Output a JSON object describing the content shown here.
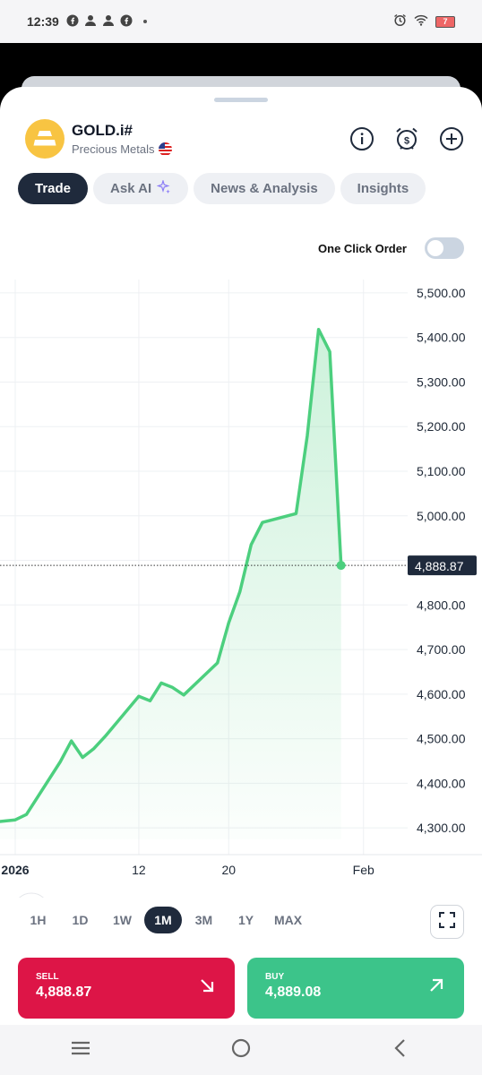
{
  "status_bar": {
    "time": "12:39",
    "battery": "7"
  },
  "instrument": {
    "symbol": "GOLD.i#",
    "category": "Precious Metals"
  },
  "tabs": [
    {
      "label": "Trade",
      "active": true
    },
    {
      "label": "Ask AI",
      "active": false
    },
    {
      "label": "News & Analysis",
      "active": false
    },
    {
      "label": "Insights",
      "active": false
    }
  ],
  "one_click": {
    "label": "One Click Order",
    "enabled": false
  },
  "chart_data": {
    "type": "area",
    "x": [
      "2026-01-01",
      "2026-01-02",
      "2026-01-05",
      "2026-01-06",
      "2026-01-07",
      "2026-01-08",
      "2026-01-09",
      "2026-01-12",
      "2026-01-13",
      "2026-01-14",
      "2026-01-15",
      "2026-01-16",
      "2026-01-19",
      "2026-01-20",
      "2026-01-21",
      "2026-01-22",
      "2026-01-23",
      "2026-01-26",
      "2026-01-27",
      "2026-01-28",
      "2026-01-29",
      "2026-01-30"
    ],
    "values": [
      4318,
      4330,
      4448,
      4495,
      4458,
      4478,
      4505,
      4595,
      4585,
      4625,
      4615,
      4598,
      4670,
      4760,
      4830,
      4935,
      4985,
      5005,
      5180,
      5418,
      5368,
      4888.87
    ],
    "x_tick_labels": [
      "2026",
      "12",
      "20",
      "Feb"
    ],
    "y_tick_labels": [
      "5,500.00",
      "5,400.00",
      "5,300.00",
      "5,200.00",
      "5,100.00",
      "5,000.00",
      "4,900.00",
      "4,800.00",
      "4,700.00",
      "4,600.00",
      "4,500.00",
      "4,400.00",
      "4,300.00"
    ],
    "ylim": [
      4240,
      5530
    ],
    "current_price_label": "4,888.87",
    "current_price": 4888.87,
    "line_color": "#4ccf7e"
  },
  "timeframes": [
    {
      "label": "1H",
      "active": false
    },
    {
      "label": "1D",
      "active": false
    },
    {
      "label": "1W",
      "active": false
    },
    {
      "label": "1M",
      "active": true
    },
    {
      "label": "3M",
      "active": false
    },
    {
      "label": "1Y",
      "active": false
    },
    {
      "label": "MAX",
      "active": false
    }
  ],
  "sell": {
    "label": "SELL",
    "price": "4,888.87",
    "color": "#dd1547"
  },
  "buy": {
    "label": "BUY",
    "price": "4,889.08",
    "color": "#3cc48a"
  }
}
